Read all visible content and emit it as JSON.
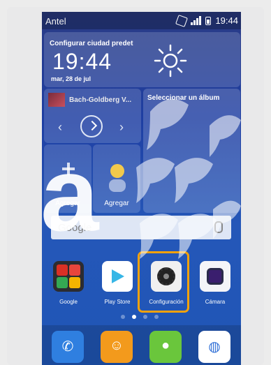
{
  "status_bar": {
    "carrier": "Antel",
    "time": "19:44"
  },
  "weather_widget": {
    "city_label": "Configurar ciudad predet",
    "time": "19:44",
    "date": "mar, 28 de jul"
  },
  "music_widget": {
    "track": "Bach-Goldberg V...",
    "prev_icon": "‹",
    "next_icon": "›"
  },
  "album_widget": {
    "label": "Seleccionar un álbum"
  },
  "add_widgets": [
    {
      "label": "Agregar"
    },
    {
      "label": "Agregar"
    }
  ],
  "search_bar": {
    "placeholder": "Google"
  },
  "apps": [
    {
      "label": "Google"
    },
    {
      "label": "Play Store"
    },
    {
      "label": "Configuración"
    },
    {
      "label": "Cámara"
    }
  ],
  "page_indicator": {
    "count": 4,
    "active_index": 1
  },
  "dock": {
    "phone_icon": "✆",
    "contacts_icon": "☺",
    "messages_icon": "●",
    "browser_icon": "◍"
  },
  "colors": {
    "highlight": "#f4a20b",
    "wallpaper": "#1e3ea2"
  },
  "watermark": {
    "glyph": "a"
  }
}
